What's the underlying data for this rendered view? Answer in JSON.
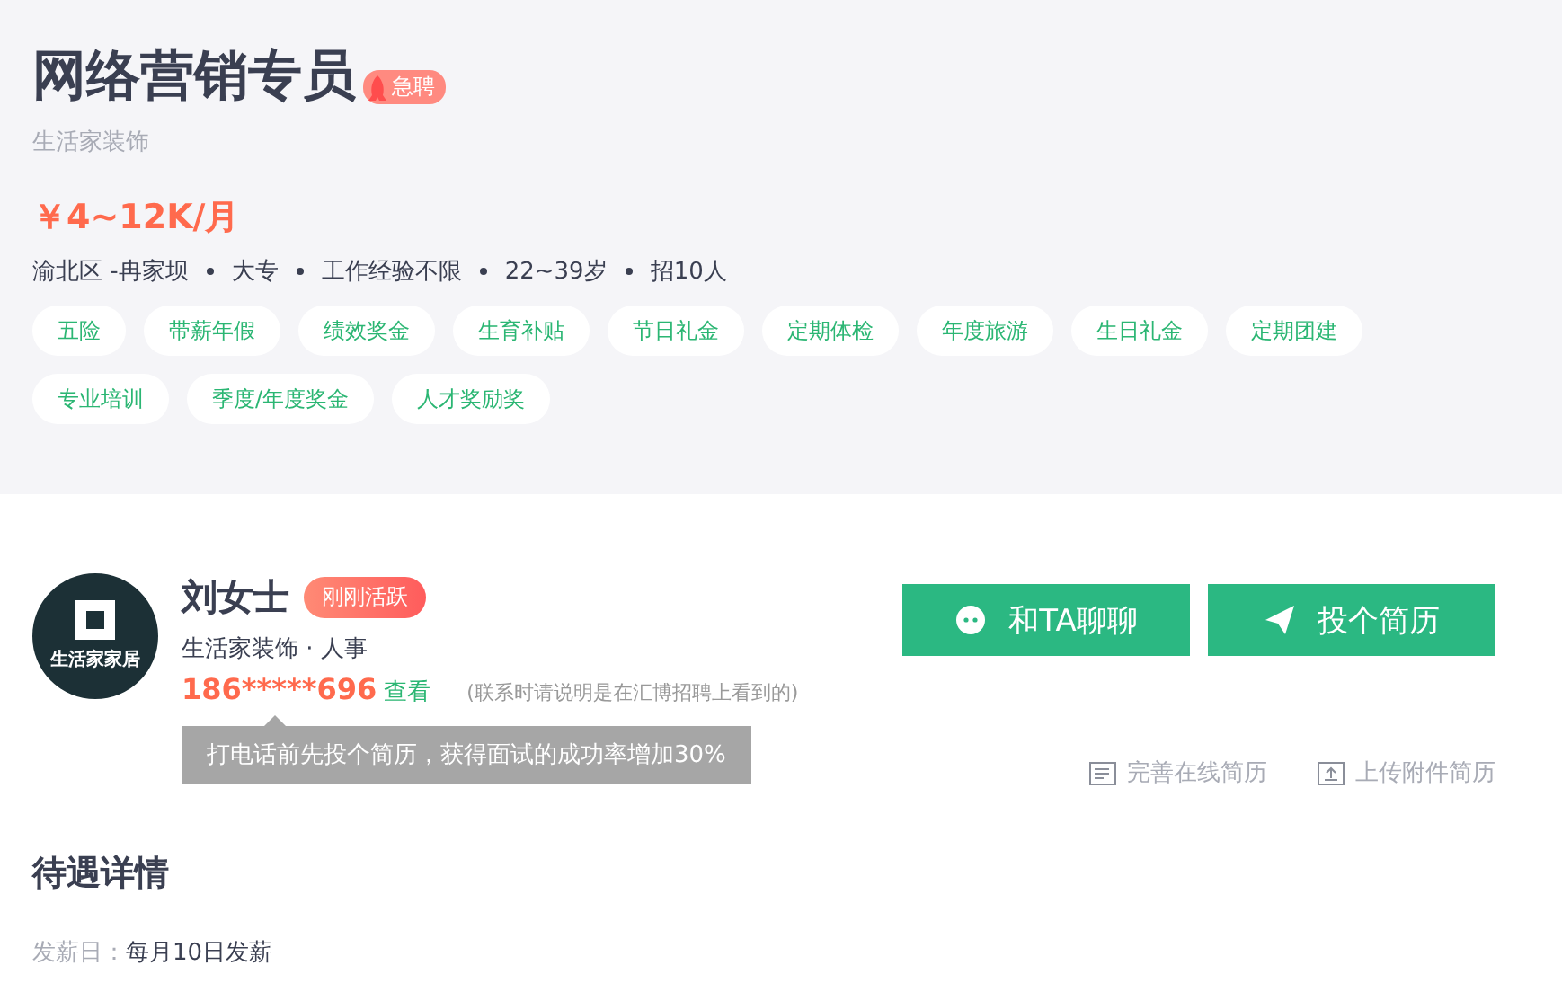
{
  "job": {
    "title": "网络营销专员",
    "urgent_badge": "急聘",
    "company": "生活家装饰",
    "salary": "￥4~12K/月",
    "meta": [
      "渝北区 -冉家坝",
      "大专",
      "工作经验不限",
      "22~39岁",
      "招10人"
    ],
    "tags": [
      "五险",
      "带薪年假",
      "绩效奖金",
      "生育补贴",
      "节日礼金",
      "定期体检",
      "年度旅游",
      "生日礼金",
      "定期团建",
      "专业培训",
      "季度/年度奖金",
      "人才奖励奖"
    ]
  },
  "recruiter": {
    "logo_text": "生活家家居",
    "name": "刘女士",
    "status_badge": "刚刚活跃",
    "role": "生活家装饰 · 人事",
    "phone": "186*****696",
    "view_link": "查看",
    "note": "(联系时请说明是在汇博招聘上看到的)",
    "tooltip": "打电话前先投个简历，获得面试的成功率增加30%"
  },
  "actions": [
    {
      "kind": "chat",
      "label": "和TA聊聊"
    },
    {
      "kind": "send",
      "label": "投个简历"
    }
  ],
  "resume_links": [
    {
      "kind": "edit",
      "label": "完善在线简历"
    },
    {
      "kind": "upload",
      "label": "上传附件简历"
    }
  ],
  "benefits": {
    "heading": "待遇详情",
    "rows": [
      {
        "label": "发薪日：",
        "value": "每月10日发薪"
      }
    ]
  }
}
